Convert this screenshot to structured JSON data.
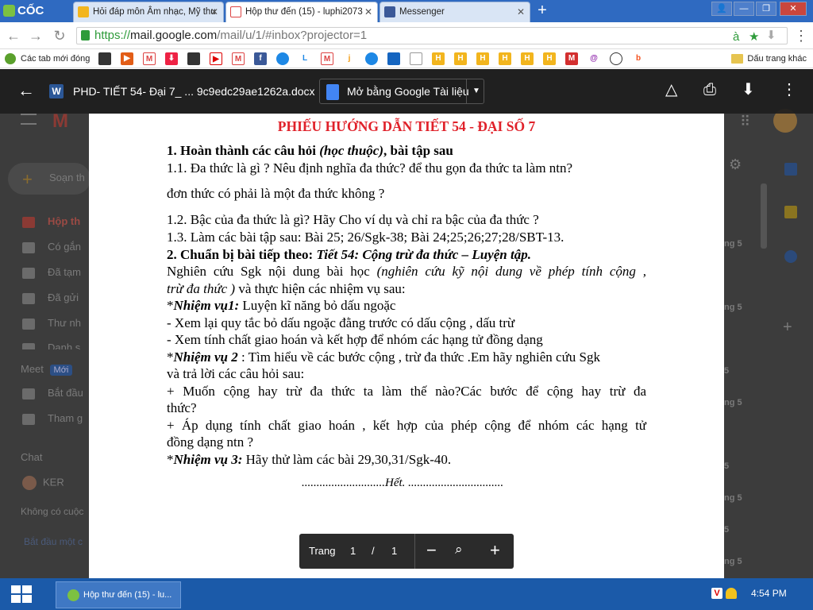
{
  "browser": {
    "brand": "CỐC CỐC",
    "tabs": [
      {
        "label": "Hỏi đáp môn Âm nhạc, Mỹ thu",
        "active": false
      },
      {
        "label": "Hộp thư đến (15) - luphi2073",
        "active": true
      },
      {
        "label": "Messenger",
        "active": false
      }
    ],
    "url_scheme": "https://",
    "url_host": "mail.google.com",
    "url_path": "/mail/u/1/#inbox?projector=1",
    "bookmarks_first": "Các tab mới đóng",
    "bookmarks_other": "Dấu trang khác"
  },
  "gmail_background": {
    "compose": "Soạn th",
    "nav": [
      "Hộp th",
      "Có gắn",
      "Đã tạm",
      "Đã gửi",
      "Thư nh",
      "Danh s"
    ],
    "meet_label": "Meet",
    "meet_badge": "Mới",
    "meet_items": [
      "Bắt đầu",
      "Tham g"
    ],
    "chat_label": "Chat",
    "chat_user": "KER",
    "no_conv": "Không có cuộc",
    "start_conv": "Bắt đầu một c",
    "row_nums": [
      "ng 5",
      "ng 5",
      "5",
      "ng 5",
      "5",
      "ng 5",
      "5",
      "ng 5"
    ]
  },
  "viewer": {
    "file_name": "PHD- TIẾT 54- Đại 7_ ... 9c9edc29ae1262a.docx",
    "open_with": "Mở bằng Google Tài liệu",
    "page_label": "Trang",
    "page_current": "1",
    "page_sep": "/",
    "page_total": "1"
  },
  "doc": {
    "title": "PHIẾU HƯỚNG DẪN  TIẾT 54 - ĐẠI SỐ 7",
    "s1_heading_a": "1. Hoàn thành các câu hỏi ",
    "s1_heading_b": "(học thuộc)",
    "s1_heading_c": ", bài tập sau",
    "q11": "1.1. Đa thức là gì ? Nêu định nghĩa đa thức? để thu gọn đa thức ta làm ntn?",
    "q11b": "đơn thức có phải là một đa thức không ?",
    "q12": "1.2. Bậc của đa thức là gì? Hãy Cho ví dụ và chỉ ra bậc của đa thức ?",
    "q13": "1.3. Làm các bài tập sau: Bài 25; 26/Sgk-38; Bài 24;25;26;27;28/SBT-13.",
    "s2_a": "2. Chuẩn bị bài tiếp theo: ",
    "s2_b": "Tiết 54: Cộng trừ đa thức – Luyện tập.",
    "p1_a": "Nghiên cứu Sgk nội dung bài học ",
    "p1_b": "(nghiên cứu kỹ nội dung về phép tính cộng ,",
    "p2_a": "trừ đa thức )",
    "p2_b": " và thực hiện các nhiệm vụ sau:",
    "nv1_star": "*",
    "nv1_label": "Nhiệm vụ1:",
    "nv1_text": " Luyện kĩ năng bỏ dấu ngoặc",
    "nv1_a": "- Xem lại quy tắc bỏ dấu ngoặc đằng trước có dấu cộng , dấu trừ",
    "nv1_b": "- Xem tính chất giao hoán và kết hợp để nhóm các hạng tử đồng dạng",
    "nv2_star": "*",
    "nv2_label": "Nhiệm vụ 2",
    "nv2_text": " : Tìm hiểu về các bước cộng , trừ đa thức .Em hãy nghiên cứu Sgk",
    "nv2_b": "và trả lời các câu hỏi sau:",
    "nv2_q1a": " + Muốn cộng hay trừ đa thức ta làm thế nào?Các bước để cộng hay trừ đa",
    "nv2_q1b": "thức?",
    "nv2_q2a": " + Áp dụng tính chất giao hoán , kết hợp của phép cộng để nhóm các hạng tử",
    "nv2_q2b": "đồng dạng ntn ?",
    "nv3_star": "*",
    "nv3_label": "Nhiệm vụ 3:",
    "nv3_text": " Hãy thử làm các bài 29,30,31/Sgk-40.",
    "end": "............................Hết. ................................"
  },
  "taskbar": {
    "task_label": "Hộp thư đến (15) - lu...",
    "clock": "4:54 PM"
  },
  "colors": {
    "title_red": "#e0212a",
    "tabbar_blue": "#2f6ac1",
    "taskbar_blue": "#1b5aa9"
  }
}
